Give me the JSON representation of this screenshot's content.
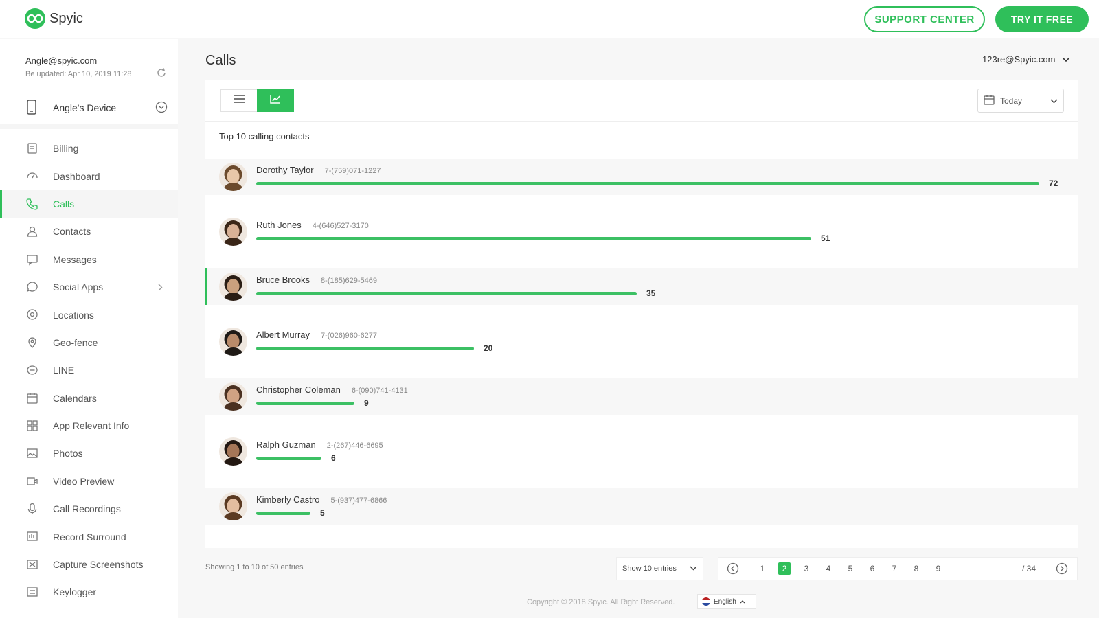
{
  "header": {
    "brand": "Spyic",
    "support_label": "SUPPORT CENTER",
    "try_label": "TRY IT FREE"
  },
  "account": {
    "email": "Angle@spyic.com",
    "updated": "Be updated: Apr 10, 2019 11:28",
    "device": "Angle's Device"
  },
  "sidebar": {
    "items": [
      {
        "label": "Billing",
        "icon": "billing-icon"
      },
      {
        "label": "Dashboard",
        "icon": "dashboard-icon"
      },
      {
        "label": "Calls",
        "icon": "phone-icon",
        "active": true
      },
      {
        "label": "Contacts",
        "icon": "contacts-icon"
      },
      {
        "label": "Messages",
        "icon": "message-icon"
      },
      {
        "label": "Social Apps",
        "icon": "chat-bubble-icon",
        "has_submenu": true
      },
      {
        "label": "Locations",
        "icon": "location-pin-icon"
      },
      {
        "label": "Geo-fence",
        "icon": "geofence-icon"
      },
      {
        "label": "LINE",
        "icon": "line-app-icon"
      },
      {
        "label": "Calendars",
        "icon": "calendar-icon"
      },
      {
        "label": "App Relevant Info",
        "icon": "apps-grid-icon"
      },
      {
        "label": "Photos",
        "icon": "photo-icon"
      },
      {
        "label": "Video Preview",
        "icon": "video-icon"
      },
      {
        "label": "Call Recordings",
        "icon": "microphone-icon"
      },
      {
        "label": "Record Surround",
        "icon": "record-icon"
      },
      {
        "label": "Capture Screenshots",
        "icon": "screenshot-icon"
      },
      {
        "label": "Keylogger",
        "icon": "keyboard-icon"
      }
    ]
  },
  "main": {
    "title": "Calls",
    "account_select": "123re@Spyic.com",
    "date_filter": "Today",
    "chart_title": "Top 10 calling contacts"
  },
  "contacts": [
    {
      "name": "Dorothy Taylor",
      "phone": "7-(759)071-1227",
      "calls": 72
    },
    {
      "name": "Ruth Jones",
      "phone": "4-(646)527-3170",
      "calls": 51
    },
    {
      "name": "Bruce Brooks",
      "phone": "8-(185)629-5469",
      "calls": 35
    },
    {
      "name": "Albert Murray",
      "phone": "7-(026)960-6277",
      "calls": 20
    },
    {
      "name": "Christopher Coleman",
      "phone": "6-(090)741-4131",
      "calls": 9
    },
    {
      "name": "Ralph Guzman",
      "phone": "2-(267)446-6695",
      "calls": 6
    },
    {
      "name": "Kimberly Castro",
      "phone": "5-(937)477-6866",
      "calls": 5
    }
  ],
  "footer": {
    "showing": "Showing 1 to 10 of 50 entries",
    "entries_select": "Show 10 entries",
    "pages": [
      "1",
      "2",
      "3",
      "4",
      "5",
      "6",
      "7",
      "8",
      "9"
    ],
    "current_page": "2",
    "total_pages": "/ 34",
    "copyright": "Copyright © 2018 Spyic. All Right Reserved.",
    "language": "English"
  },
  "colors": {
    "accent": "#2fbf5a",
    "bar": "#3cc064"
  }
}
